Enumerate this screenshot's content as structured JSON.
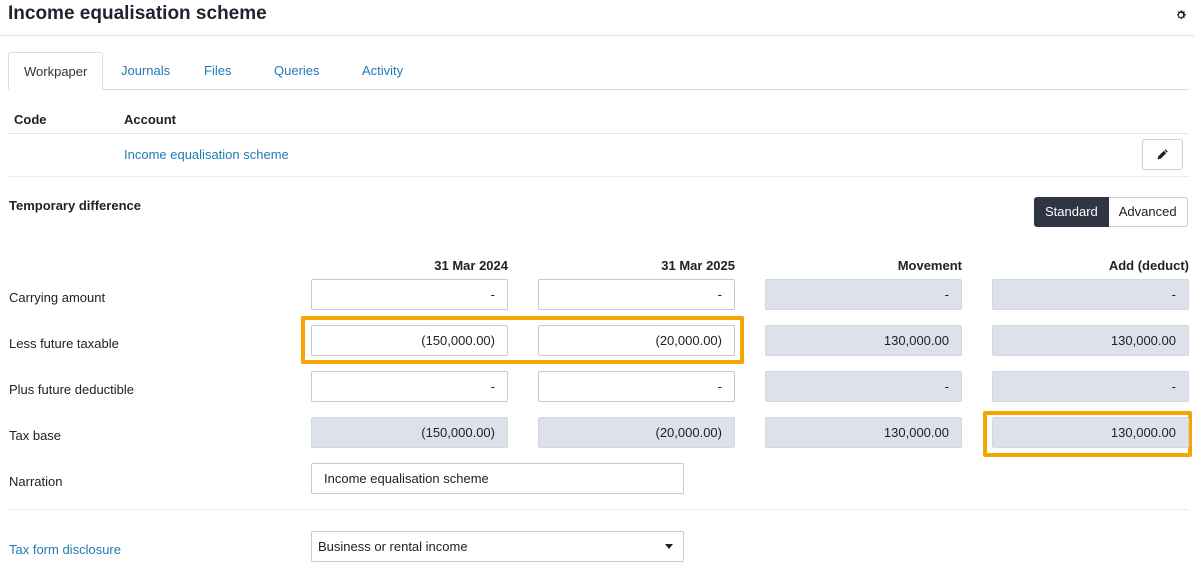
{
  "page": {
    "title": "Income equalisation scheme"
  },
  "tabs": [
    "Workpaper",
    "Journals",
    "Files",
    "Queries",
    "Activity"
  ],
  "accounts_table": {
    "headers": {
      "code": "Code",
      "account": "Account"
    },
    "row": {
      "code": "",
      "account": "Income equalisation scheme"
    }
  },
  "temporary_difference": {
    "title": "Temporary difference",
    "modes": {
      "standard": "Standard",
      "advanced": "Advanced"
    },
    "columns": [
      "31 Mar 2024",
      "31 Mar 2025",
      "Movement",
      "Add (deduct)"
    ],
    "rows": [
      {
        "label": "Carrying amount",
        "values": [
          "-",
          "-",
          "-",
          "-"
        ]
      },
      {
        "label": "Less future taxable",
        "values": [
          "(150,000.00)",
          "(20,000.00)",
          "130,000.00",
          "130,000.00"
        ]
      },
      {
        "label": "Plus future deductible",
        "values": [
          "-",
          "-",
          "-",
          "-"
        ]
      },
      {
        "label": "Tax base",
        "values": [
          "(150,000.00)",
          "(20,000.00)",
          "130,000.00",
          "130,000.00"
        ]
      }
    ],
    "narration": {
      "label": "Narration",
      "value": "Income equalisation scheme"
    }
  },
  "tax_form_disclosure": {
    "label": "Tax form disclosure",
    "value": "Business or rental income"
  },
  "colors": {
    "accent": "#1f7bb8",
    "highlight": "#f7a500",
    "dark_button": "#2f3542",
    "readonly_cell": "#dde2ea"
  },
  "icons": {
    "settings": "gear-icon",
    "edit": "pencil-icon",
    "dropdown": "chevron-down-icon"
  }
}
